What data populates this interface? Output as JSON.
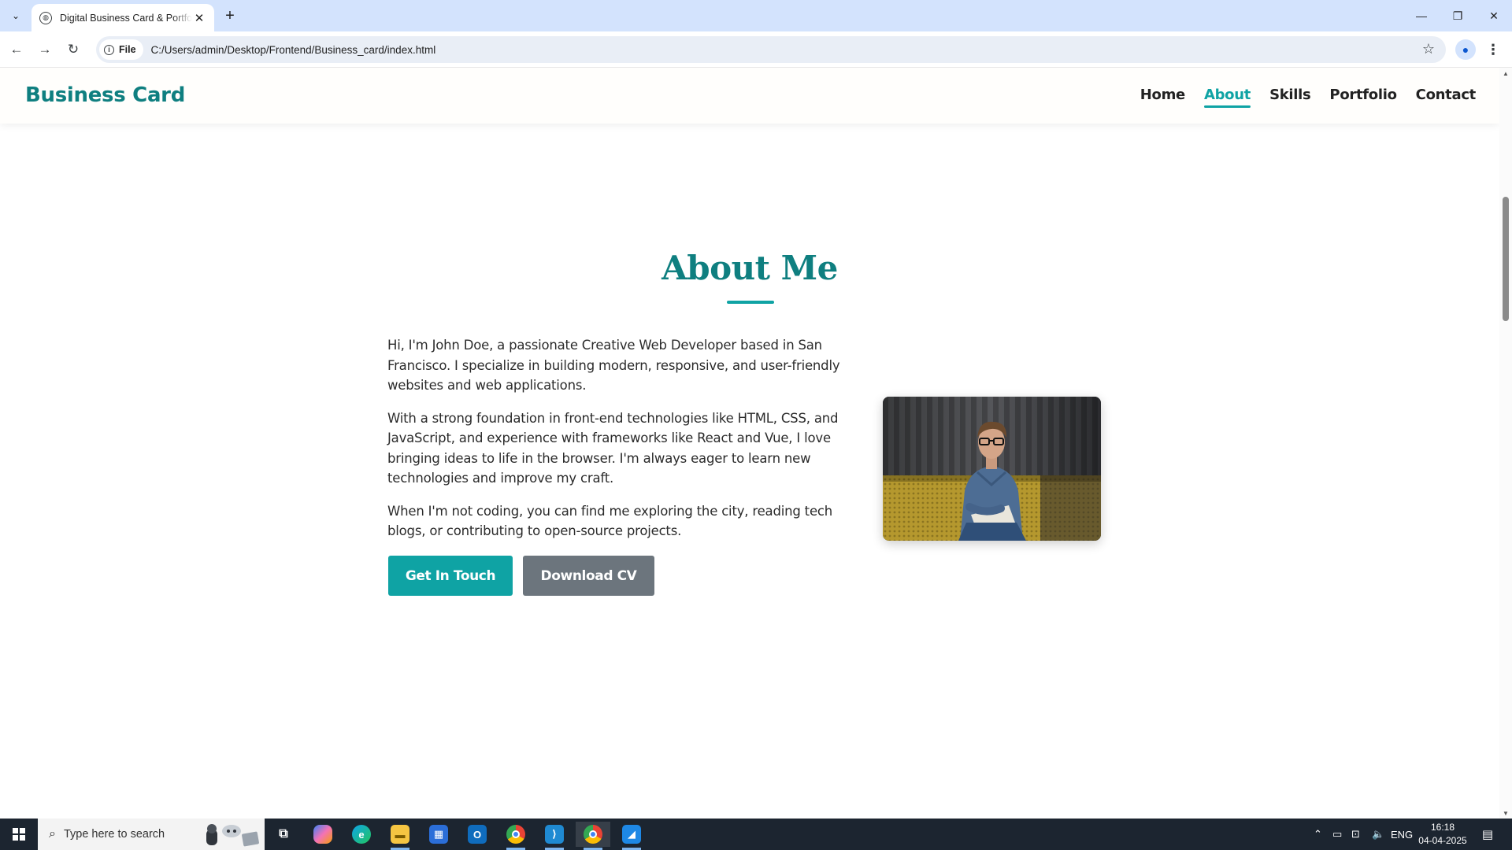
{
  "browser": {
    "tab_title": "Digital Business Card & Portfolio",
    "tab_close": "✕",
    "new_tab": "+",
    "url_chip_label": "File",
    "url": "C:/Users/admin/Desktop/Frontend/Business_card/index.html",
    "window_controls": {
      "minimize": "—",
      "restore": "❐",
      "close": "✕"
    }
  },
  "site": {
    "brand": "Business Card",
    "nav": [
      {
        "label": "Home",
        "active": false
      },
      {
        "label": "About",
        "active": true
      },
      {
        "label": "Skills",
        "active": false
      },
      {
        "label": "Portfolio",
        "active": false
      },
      {
        "label": "Contact",
        "active": false
      }
    ],
    "about": {
      "title": "About Me",
      "paragraphs": [
        "Hi, I'm John Doe, a passionate Creative Web Developer based in San Francisco. I specialize in building modern, responsive, and user-friendly websites and web applications.",
        "With a strong foundation in front-end technologies like HTML, CSS, and JavaScript, and experience with frameworks like React and Vue, I love bringing ideas to life in the browser. I'm always eager to learn new technologies and improve my craft.",
        "When I'm not coding, you can find me exploring the city, reading tech blogs, or contributing to open-source projects."
      ],
      "primary_button": "Get In Touch",
      "secondary_button": "Download CV"
    },
    "colors": {
      "accent": "#0fa3a4",
      "brand": "#0f7f80",
      "secondary_button": "#6c757d"
    }
  },
  "taskbar": {
    "search_placeholder": "Type here to search",
    "tray_language": "ENG",
    "time": "16:18",
    "date": "04-04-2025",
    "pinned_icons": [
      "task-view-icon",
      "copilot-icon",
      "edge-icon",
      "file-explorer-icon",
      "store-icon",
      "outlook-icon",
      "chrome-icon",
      "vscode-icon",
      "chrome-active-icon",
      "remote-desktop-icon"
    ]
  }
}
